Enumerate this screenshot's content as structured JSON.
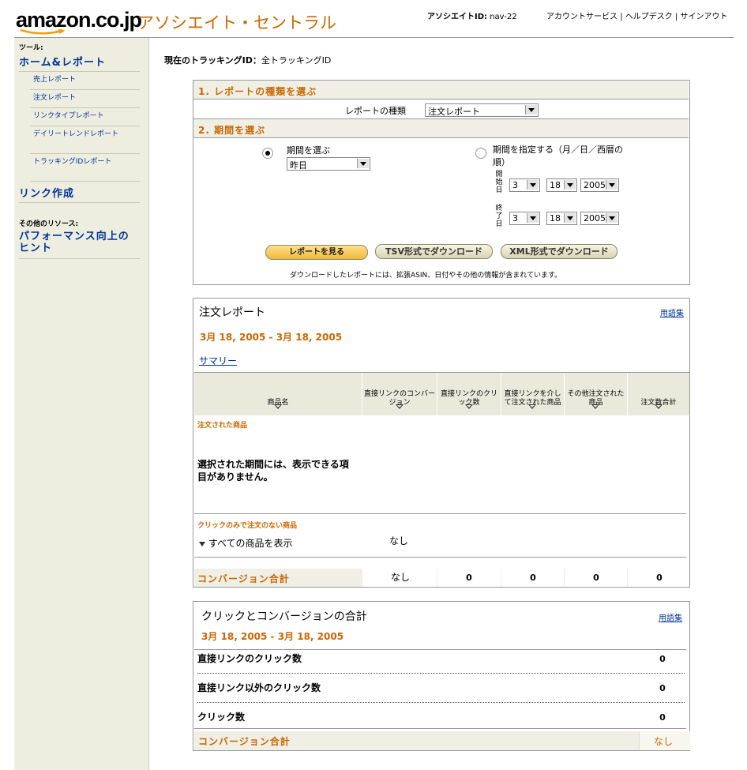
{
  "header": {
    "logo": "amazon.co.jp",
    "app_title": "アソシエイト・セントラル",
    "associate_id_label": "アソシエイトID:",
    "associate_id": "nav-22",
    "links": [
      "アカウントサービス",
      "ヘルプデスク",
      "サインアウト"
    ],
    "link_separator": "|"
  },
  "sidebar": {
    "tools_label": "ツール:",
    "home_report": "ホーム&レポート",
    "items": [
      "売上レポート",
      "注文レポート",
      "リンクタイプレポート",
      "デイリートレンドレポート",
      "トラッキングIDレポート"
    ],
    "link_create": "リンク作成",
    "other_resources_label": "その他のリソース:",
    "performance_hint": "パフォーマンス向上のヒント"
  },
  "tracking": {
    "label": "現在のトラッキングID：",
    "value": "全トラッキングID"
  },
  "report_form": {
    "step1_title": "1. レポートの種類を選ぶ",
    "report_type_label": "レポートの種類",
    "report_type_value": "注文レポート",
    "step2_title": "2. 期間を選ぶ",
    "period_choose_label": "期間を選ぶ",
    "period_choose_value": "昨日",
    "period_specify_label": "期間を指定する（月／日／西暦の順）",
    "start_label": "開始日",
    "end_label": "終了日",
    "start": {
      "month": "3",
      "day": "18",
      "year": "2005"
    },
    "end": {
      "month": "3",
      "day": "18",
      "year": "2005"
    },
    "buttons": {
      "view": "レポートを見る",
      "tsv": "TSV形式でダウンロード",
      "xml": "XML形式でダウンロード"
    },
    "note": "ダウンロードしたレポートには、拡張ASIN、日付やその他の情報が含まれています。"
  },
  "order_report": {
    "title": "注文レポート",
    "glossary": "用語集",
    "date_range": "3月 18, 2005 - 3月 18, 2005",
    "summary_link": "サマリー",
    "columns": [
      "商品名",
      "直接リンクのコンバージョン",
      "直接リンクのクリック数",
      "直接リンクを介して注文された商品",
      "その他注文された商品",
      "注文数合計"
    ],
    "ordered_section": "注文された商品",
    "no_items": "選択された期間には、表示できる項目がありません。",
    "click_only_section": "クリックのみで注文のない商品",
    "show_all": "すべての商品を表示",
    "show_all_value": "なし",
    "conversion_total_label": "コンバージョン合計",
    "totals": [
      "なし",
      "0",
      "0",
      "0",
      "0"
    ]
  },
  "click_conversion": {
    "title": "クリックとコンバージョンの合計",
    "glossary": "用語集",
    "date_range": "3月 18, 2005 - 3月 18, 2005",
    "rows": [
      {
        "label": "直接リンクのクリック数",
        "value": "0"
      },
      {
        "label": "直接リンク以外のクリック数",
        "value": "0"
      },
      {
        "label": "クリック数",
        "value": "0"
      }
    ],
    "conversion_total_label": "コンバージョン合計",
    "conversion_total_value": "なし"
  },
  "colors": {
    "accent": "#cc6600",
    "link": "#003399",
    "sidebar": "#eeeee0",
    "header_band": "#efefe6"
  }
}
